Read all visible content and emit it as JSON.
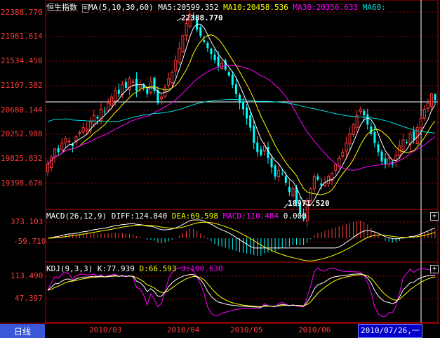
{
  "main_header": {
    "title": "恒生指数",
    "ma_label": "MA(5,10,30,60)",
    "ma5": "MA5:20599.352",
    "ma10": "MA10:20458.536",
    "ma30": "MA30:20356.633",
    "ma60": "MA60:"
  },
  "price_axis": [
    "22388.770",
    "21961.614",
    "21534.458",
    "21107.302",
    "20680.144",
    "20252.988",
    "19825.832",
    "19398.676"
  ],
  "annotations": {
    "high": "22388.770",
    "low": "18971.520"
  },
  "macd_header": {
    "label": "MACD(26,12,9)",
    "diff": "DIFF:124.840",
    "dea": "DEA:69.598",
    "macd": "MACD:110.484",
    "zero": "0.000"
  },
  "macd_axis": [
    "373.103",
    "-59.710"
  ],
  "kdj_header": {
    "label": "KDJ(9,3,3)",
    "k": "K:77.939",
    "d": "D:66.593",
    "j": "J:100.630"
  },
  "kdj_axis": [
    "113.490",
    "47.397"
  ],
  "x_axis": [
    "2010/03",
    "2010/04",
    "2010/05",
    "2010/06"
  ],
  "footer": {
    "tab": "日线",
    "date": "2010/07/26,一"
  },
  "panel_buttons": {
    "macd": "+",
    "kdj": "+"
  },
  "colors": {
    "up": "#ff3b3b",
    "down": "#00ffff",
    "ma5": "#ffffff",
    "ma10": "#ffff00",
    "ma30": "#ff00ff",
    "ma60": "#00e0e0",
    "grid": "#a00000",
    "frame": "#c00000"
  },
  "chart_data": [
    {
      "type": "candlestick",
      "series_names": [
        "MA5",
        "MA10",
        "MA30",
        "MA60"
      ],
      "ylim": [
        19290,
        22390
      ],
      "high": 22388.77,
      "low": 18971.52,
      "closes": [
        19900,
        20020,
        20150,
        20100,
        20250,
        20320,
        20280,
        20200,
        20350,
        20420,
        20500,
        20480,
        20600,
        20700,
        20650,
        20800,
        20750,
        20900,
        21000,
        21100,
        21050,
        21200,
        21150,
        21300,
        21250,
        21100,
        21200,
        21150,
        21050,
        21250,
        21100,
        20900,
        21000,
        21150,
        21300,
        21400,
        21600,
        21800,
        22000,
        22200,
        22350,
        22300,
        22100,
        22000,
        21900,
        21800,
        21700,
        21600,
        21500,
        21550,
        21450,
        21350,
        21200,
        21050,
        20900,
        20800,
        20650,
        20500,
        20250,
        20100,
        20050,
        20200,
        20000,
        19850,
        19700,
        19800,
        19750,
        19600,
        19450,
        19500,
        19300,
        19100,
        19000,
        19300,
        19500,
        19700,
        19650,
        19550,
        19600,
        19700,
        19750,
        19900,
        20000,
        20100,
        20250,
        20400,
        20550,
        20700,
        20800,
        20700,
        20550,
        20400,
        20250,
        20100,
        19950,
        19900,
        20000,
        19900,
        20050,
        20200,
        20300,
        20250,
        20400,
        20300,
        20500,
        20650,
        20800,
        20900,
        21050,
        20950
      ]
    },
    {
      "type": "line",
      "series_names": [
        "DIFF",
        "DEA",
        "MACD"
      ],
      "ylim": [
        -200,
        373.103
      ],
      "values": {
        "DIFF": 124.84,
        "DEA": 69.598,
        "MACD": 110.484
      }
    },
    {
      "type": "line",
      "series_names": [
        "K",
        "D",
        "J"
      ],
      "ylim": [
        -30,
        113.49
      ],
      "values": {
        "K": 77.939,
        "D": 66.593,
        "J": 100.63
      }
    }
  ]
}
